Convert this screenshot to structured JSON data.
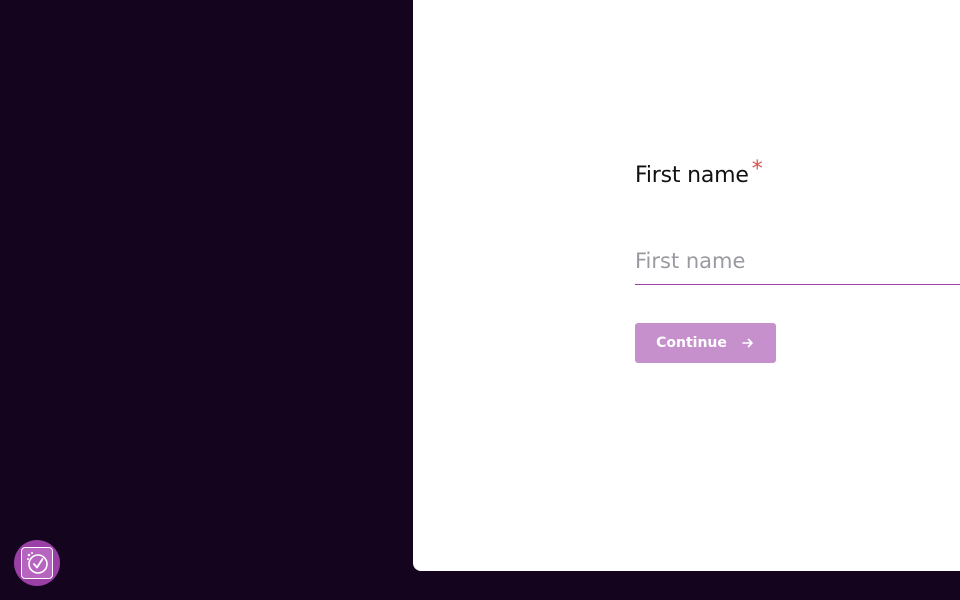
{
  "form": {
    "field_label": "First name",
    "required_marker": "*",
    "input_placeholder": "First name",
    "input_value": "",
    "continue_label": "Continue"
  },
  "icons": {
    "continue_arrow": "arrow-right-icon",
    "assistant_badge": "checklist-badge-icon"
  },
  "colors": {
    "background": "#15041e",
    "panel": "#ffffff",
    "accent": "#9b3ea8",
    "button": "#c690cc",
    "required": "#d9534f"
  }
}
